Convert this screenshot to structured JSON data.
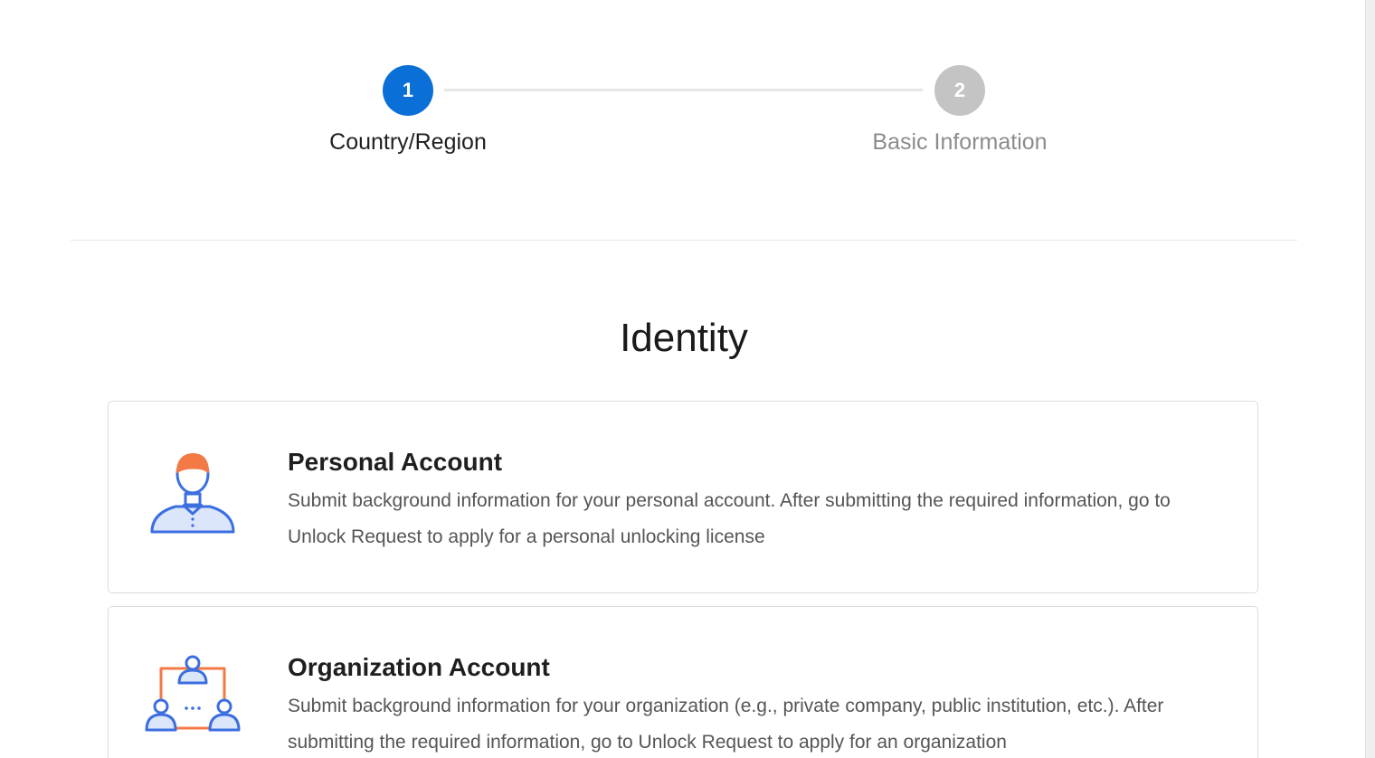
{
  "stepper": {
    "steps": [
      {
        "number": "1",
        "label": "Country/Region",
        "state": "active"
      },
      {
        "number": "2",
        "label": "Basic Information",
        "state": "inactive"
      }
    ]
  },
  "identity": {
    "title": "Identity",
    "cards": [
      {
        "icon": "person-icon",
        "title": "Personal Account",
        "description": "Submit background information for your personal account. After submitting the required information, go to Unlock Request to apply for a personal unlocking license"
      },
      {
        "icon": "organization-icon",
        "title": "Organization Account",
        "description": "Submit background information for your organization (e.g., private company, public institution, etc.). After submitting the required information, go to Unlock Request to apply for an organization"
      }
    ]
  },
  "colors": {
    "accent": "#0a6fd6",
    "inactive_step": "#c4c4c4",
    "icon_blue": "#3b6fe0",
    "icon_orange": "#f47a45"
  }
}
